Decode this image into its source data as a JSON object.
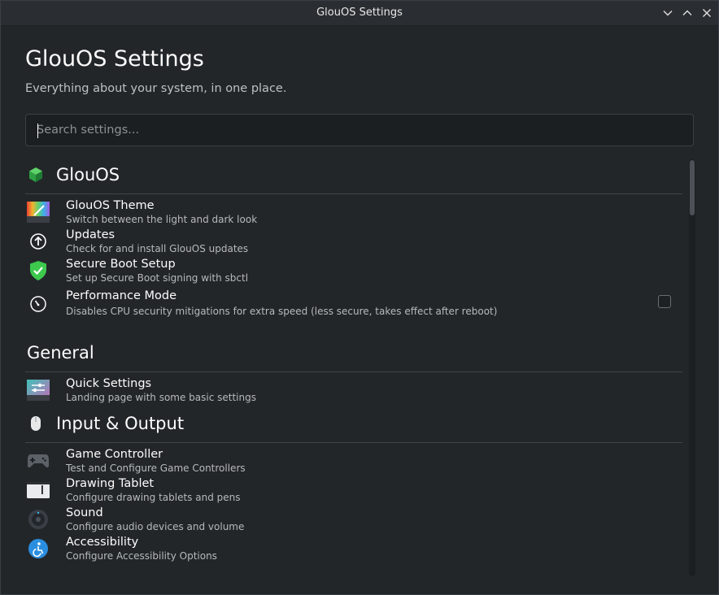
{
  "window": {
    "title": "GlouOS Settings",
    "controls": [
      "minimize",
      "maximize",
      "close"
    ]
  },
  "header": {
    "title": "GlouOS Settings",
    "subtitle": "Everything about your system, in one place."
  },
  "search": {
    "placeholder": "Search settings...",
    "value": ""
  },
  "sections": [
    {
      "title": "GlouOS",
      "icon": "green-cube-icon",
      "items": [
        {
          "title": "GlouOS Theme",
          "desc": "Switch between the light and dark look",
          "icon": "theme-palette-icon"
        },
        {
          "title": "Updates",
          "desc": "Check for and install GlouOS updates",
          "icon": "update-arrow-icon"
        },
        {
          "title": "Secure Boot Setup",
          "desc": "Set up Secure Boot signing with sbctl",
          "icon": "shield-check-icon"
        },
        {
          "title": "Performance Mode",
          "desc": "Disables CPU security mitigations for extra speed (less secure, takes effect after reboot)",
          "icon": "speedometer-icon",
          "checked": false
        }
      ]
    },
    {
      "title": "General",
      "items": [
        {
          "title": "Quick Settings",
          "desc": "Landing page with some basic settings",
          "icon": "quick-settings-icon"
        }
      ]
    },
    {
      "title": "Input & Output",
      "icon": "mouse-icon",
      "items": [
        {
          "title": "Game Controller",
          "desc": "Test and Configure Game Controllers",
          "icon": "gamepad-icon"
        },
        {
          "title": "Drawing Tablet",
          "desc": "Configure drawing tablets and pens",
          "icon": "drawing-tablet-icon"
        },
        {
          "title": "Sound",
          "desc": "Configure audio devices and volume",
          "icon": "speaker-icon"
        },
        {
          "title": "Accessibility",
          "desc": "Configure Accessibility Options",
          "icon": "accessibility-icon"
        }
      ]
    }
  ],
  "colors": {
    "background": "#232629",
    "accent": "#3daee9",
    "text": "#fcfcfc",
    "muted": "#b6b9bd"
  }
}
